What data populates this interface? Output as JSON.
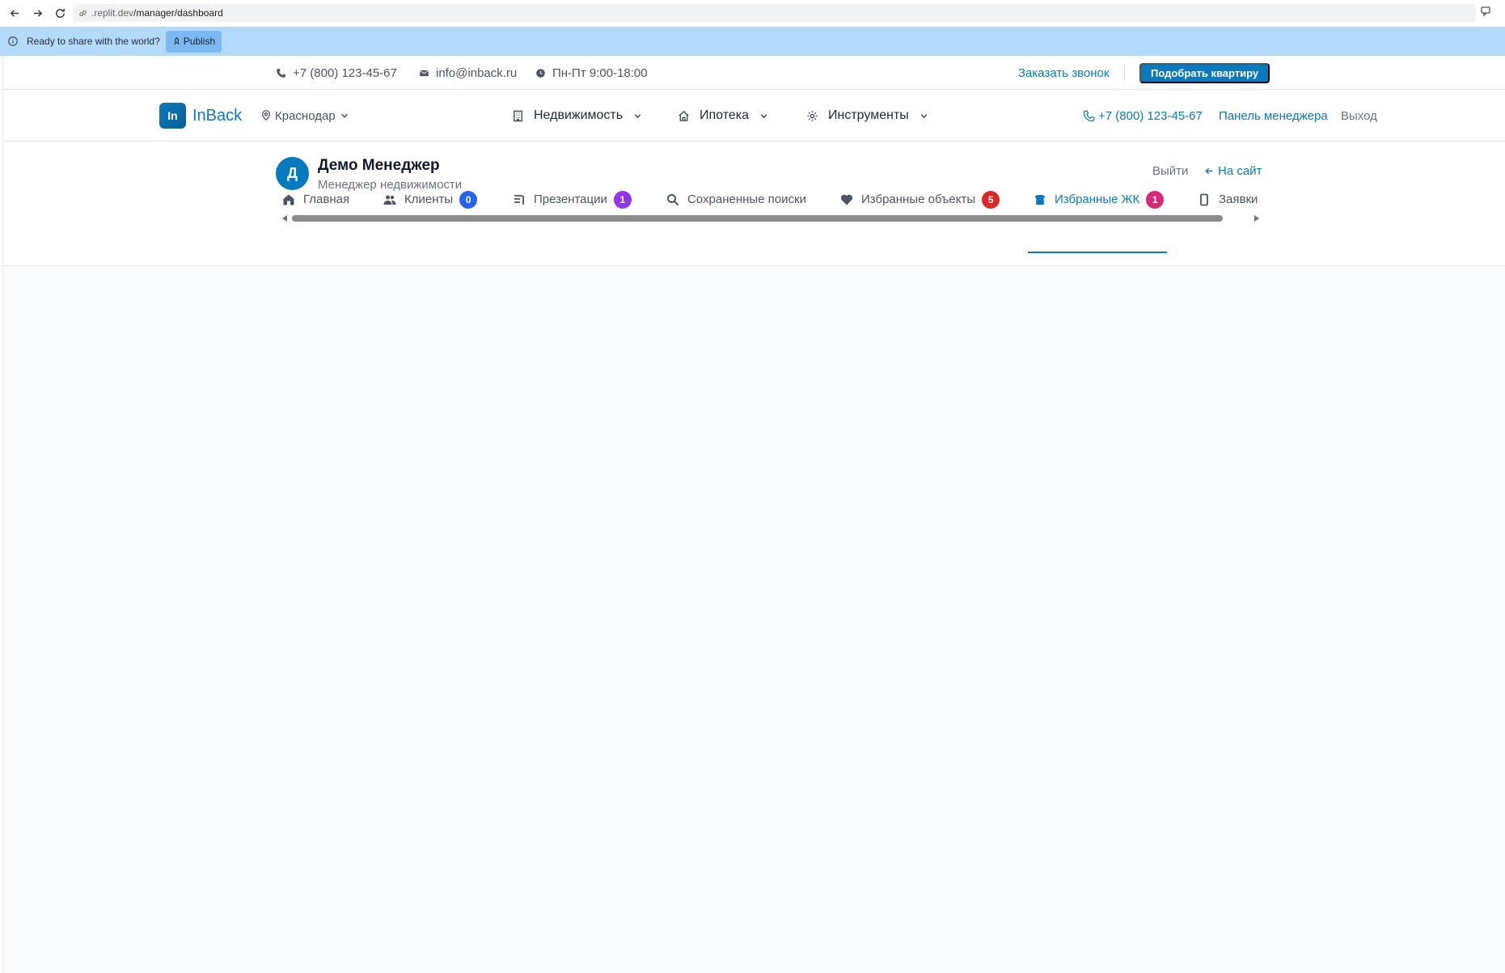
{
  "browser": {
    "url_host": ".replit.dev",
    "url_path": "/manager/dashboard"
  },
  "replit_banner": {
    "message": "Ready to share with the world?",
    "publish_label": "Publish"
  },
  "topbar": {
    "phone": "+7 (800) 123-45-67",
    "email": "info@inback.ru",
    "hours": "Пн-Пт 9:00-18:00",
    "callback_label": "Заказать звонок",
    "pick_label": "Подобрать квартиру"
  },
  "nav": {
    "logo_mark": "In",
    "logo_text": "InBack",
    "city": "Краснодар",
    "menu": [
      {
        "label": "Недвижимость",
        "icon": "building-icon"
      },
      {
        "label": "Ипотека",
        "icon": "home-icon"
      },
      {
        "label": "Инструменты",
        "icon": "gear-icon"
      }
    ],
    "phone": "+7 (800) 123-45-67",
    "panel_label": "Панель менеджера",
    "exit_label": "Выход"
  },
  "manager": {
    "avatar_initial": "Д",
    "name": "Демо Менеджер",
    "role": "Менеджер недвижимости",
    "logout_label": "Выйти",
    "to_site_label": "На сайт"
  },
  "tabs": [
    {
      "label": "Главная",
      "icon": "home-icon",
      "badge": null
    },
    {
      "label": "Клиенты",
      "icon": "users-icon",
      "badge": "0",
      "badge_color": "#2563eb"
    },
    {
      "label": "Презентации",
      "icon": "presentation-icon",
      "badge": "1",
      "badge_color": "#9333ea"
    },
    {
      "label": "Сохраненные поиски",
      "icon": "search-icon",
      "badge": null
    },
    {
      "label": "Избранные объекты",
      "icon": "heart-icon",
      "badge": "5",
      "badge_color": "#dc2626"
    },
    {
      "label": "Избранные ЖК",
      "icon": "building-icon",
      "badge": "1",
      "badge_color": "#db2777",
      "active": true
    },
    {
      "label": "Заявки",
      "icon": "phone-icon",
      "badge": null
    }
  ],
  "colors": {
    "accent": "#0a7abf",
    "banner": "#b3d9fb",
    "page_bg": "#f9fafb"
  }
}
